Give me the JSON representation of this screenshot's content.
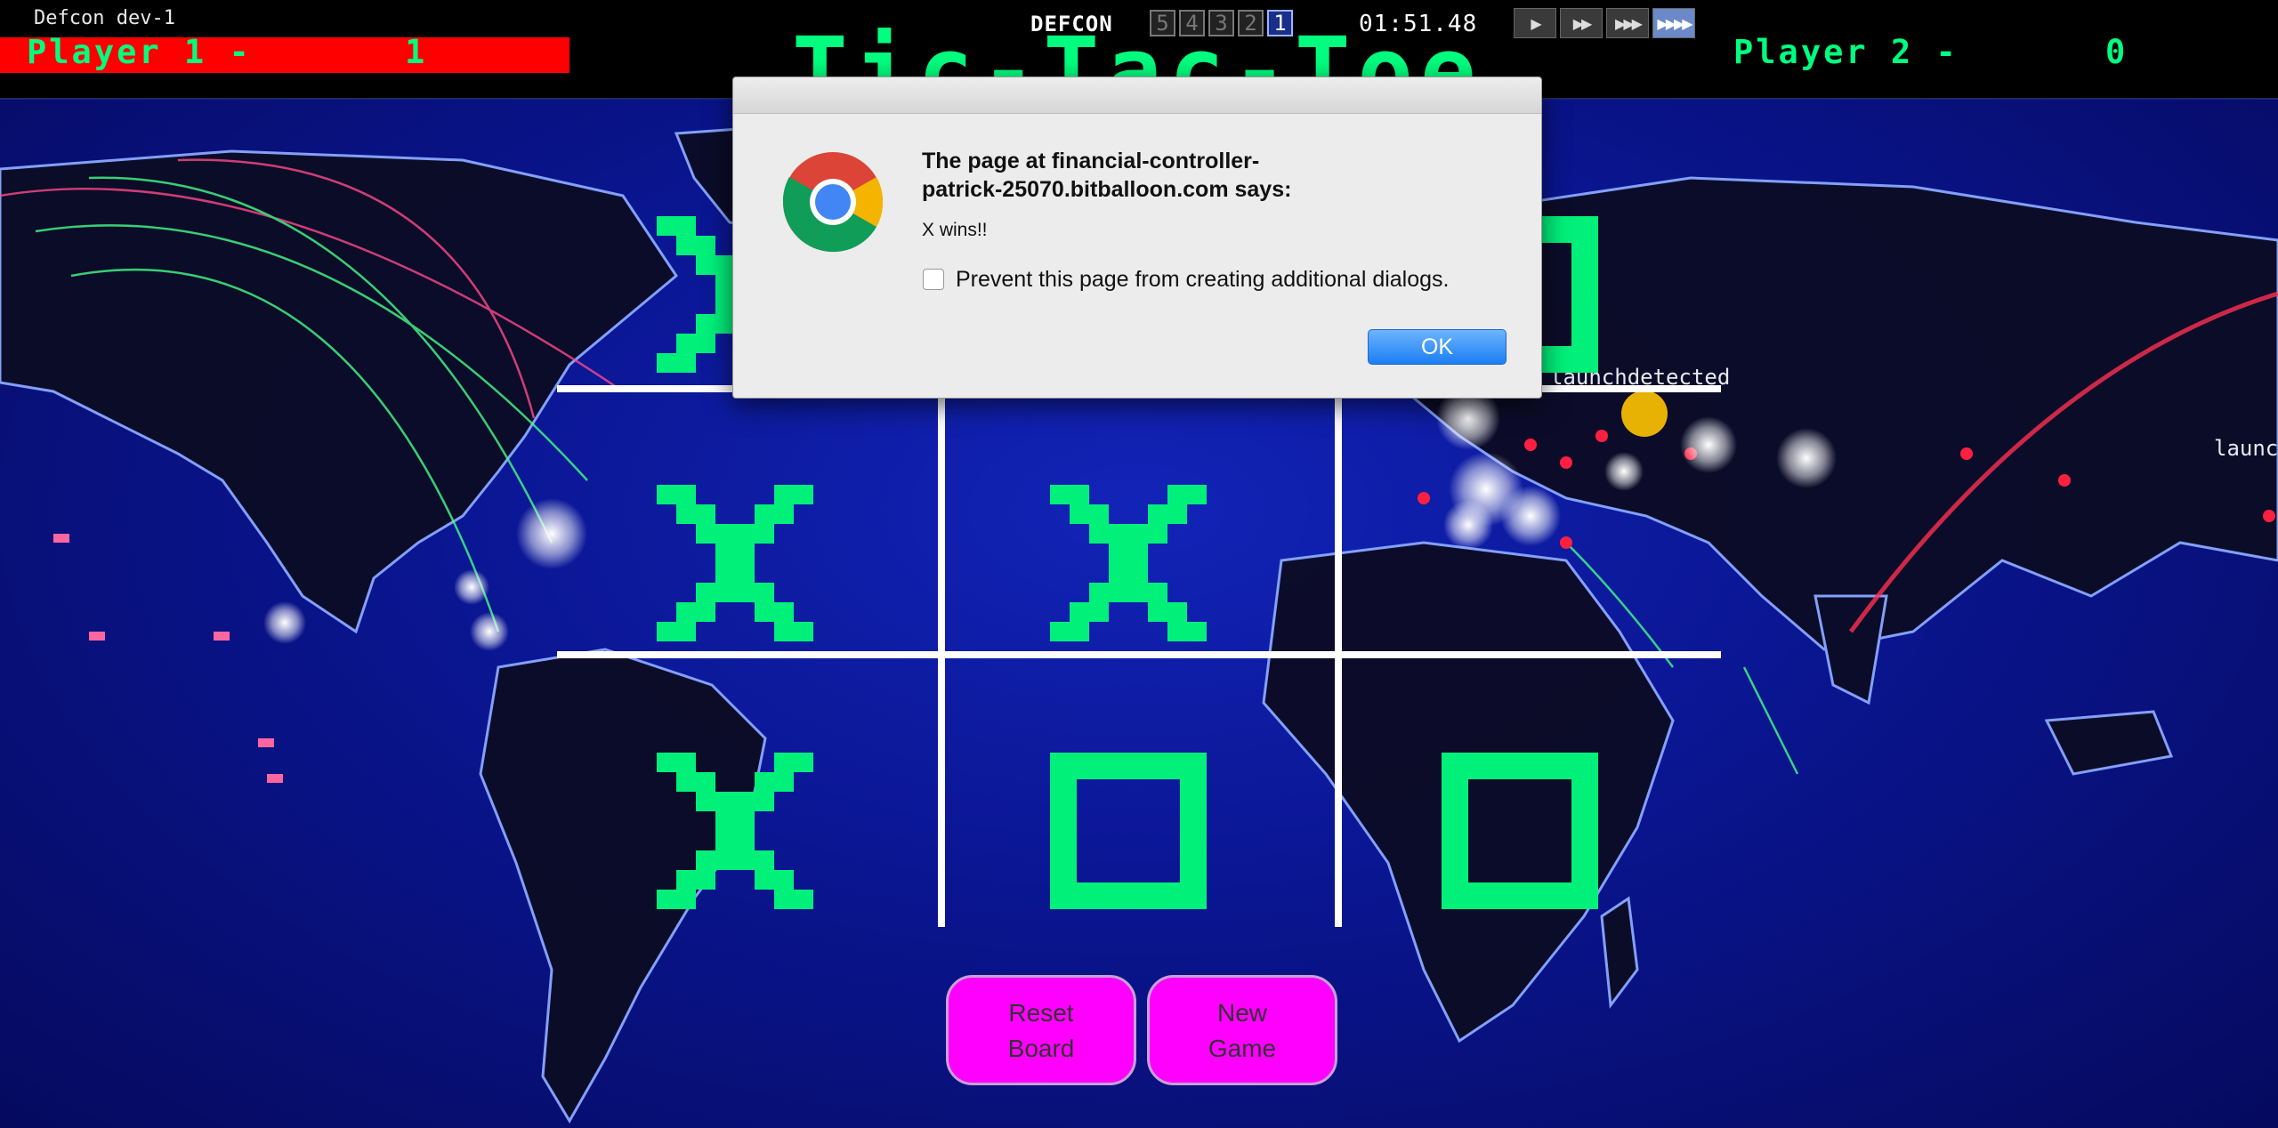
{
  "window": {
    "title": "Defcon dev-1"
  },
  "scoreboard": {
    "player1_label": "Player 1 -",
    "player1_score": "1",
    "player2_label": "Player 2 -",
    "player2_score": "0"
  },
  "game": {
    "title": "Tic-Tac-Toe"
  },
  "defcon": {
    "label": "DEFCON",
    "levels": [
      "5",
      "4",
      "3",
      "2",
      "1"
    ],
    "active_level": "1",
    "clock": "01:51.48"
  },
  "speed_controls": [
    "▶",
    "▶▶",
    "▶▶▶",
    "▶▶▶▶"
  ],
  "map": {
    "launch_label_1": "launchdetected",
    "launch_label_2": "launch"
  },
  "board": {
    "cells": [
      "X",
      "",
      "O",
      "X",
      "X",
      "",
      "X",
      "O",
      "O"
    ],
    "mark_color": "#00f07a"
  },
  "buttons": {
    "reset": [
      "Reset",
      "Board"
    ],
    "new_game": [
      "New",
      "Game"
    ]
  },
  "dialog": {
    "heading": "The page at financial-controller-\npatrick-25070.bitballoon.com says:",
    "message": "X wins!!",
    "checkbox_label": "Prevent this page from creating additional dialogs.",
    "checkbox_checked": false,
    "ok_label": "OK",
    "icon": "chrome-icon"
  },
  "colors": {
    "accent_green": "#00ff7f",
    "player1_bar": "#ff0000",
    "button_magenta": "#ff00ff",
    "ok_blue": "#1b7ff2"
  }
}
